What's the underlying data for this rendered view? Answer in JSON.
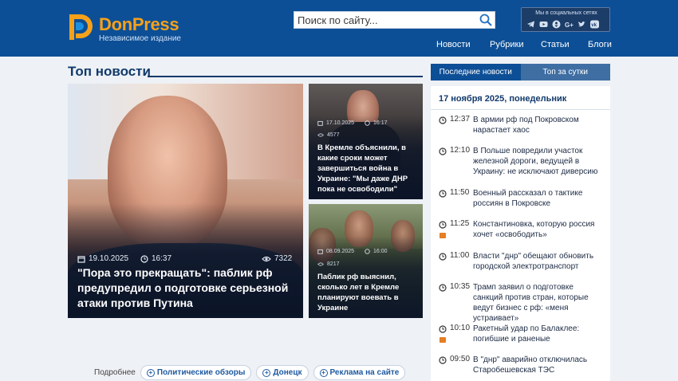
{
  "brand": {
    "name": "DonPress",
    "tagline": "Независимое издание"
  },
  "search": {
    "placeholder": "Поиск по сайту..."
  },
  "social": {
    "title": "Мы в социальных сетях",
    "icons": [
      "telegram-icon",
      "youtube-icon",
      "odnoklassniki-icon",
      "google-plus-icon",
      "twitter-icon",
      "vk-icon"
    ]
  },
  "nav": {
    "items": [
      "Новости",
      "Рубрики",
      "Статьи",
      "Блоги"
    ]
  },
  "section": {
    "title": "Топ новости"
  },
  "cards": [
    {
      "date": "19.10.2025",
      "time": "16:37",
      "views": "7322",
      "title": "\"Пора это прекращать\": паблик рф предупредил о подготовке серьезной атаки против Путина"
    },
    {
      "date": "17.10.2025",
      "time": "16:17",
      "views": "4577",
      "title": "В Кремле объяснили, в какие сроки может завершиться война в Украине: \"Мы даже ДНР пока не освободили\""
    },
    {
      "date": "08.09.2025",
      "time": "16:00",
      "views": "8217",
      "title": "Паблик рф выяснил, сколько лет в Кремле планируют воевать в Украине"
    }
  ],
  "tags": {
    "label": "Подробнее",
    "items": [
      "Политические обзоры",
      "Донецк",
      "Реклама на сайте"
    ]
  },
  "sidebar": {
    "tabs": [
      "Последние новости",
      "Топ за сутки"
    ],
    "date": "17 ноября 2025, понедельник",
    "news": [
      {
        "time": "12:37",
        "text": "В армии рф под Покровском нарастает хаос",
        "photo": false
      },
      {
        "time": "12:10",
        "text": "В Польше повредили участок железной дороги, ведущей в Украину: не исключают диверсию",
        "photo": false
      },
      {
        "time": "11:50",
        "text": "Военный рассказал о тактике россиян в Покровске",
        "photo": false
      },
      {
        "time": "11:25",
        "text": "Константиновка, которую россия хочет «освободить»",
        "photo": true
      },
      {
        "time": "11:00",
        "text": "Власти \"днр\" обещают обновить городской электротранспорт",
        "photo": false
      },
      {
        "time": "10:35",
        "text": "Трамп заявил о подготовке санкций против стран, которые ведут бизнес с рф: «меня устраивает»",
        "photo": false
      },
      {
        "time": "10:10",
        "text": "Ракетный удар по Балаклее: погибшие и раненые",
        "photo": true
      },
      {
        "time": "09:50",
        "text": "В \"днр\" аварийно отключилась Старобешевская ТЭС",
        "photo": false
      }
    ]
  },
  "colors": {
    "header": "#0d4f96",
    "brand_accent": "#f7a11a",
    "link": "#1f5aa0",
    "photo_badge": "#e67e22"
  }
}
